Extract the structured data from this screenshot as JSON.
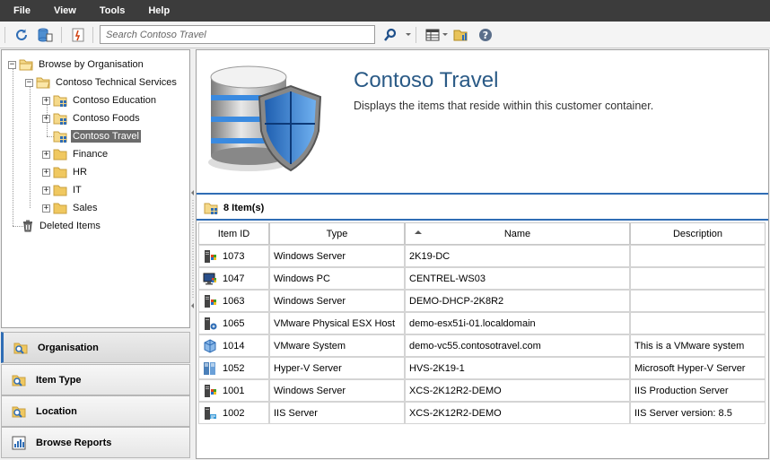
{
  "menu": [
    "File",
    "View",
    "Tools",
    "Help"
  ],
  "toolbar": {
    "search_placeholder": "Search Contoso Travel",
    "icons": [
      "refresh-icon",
      "database-icon",
      "report-icon",
      "search-icon",
      "columns-icon",
      "folder-chart-icon",
      "help-icon"
    ]
  },
  "tree": {
    "root": "Browse by Organisation",
    "customer": "Contoso Technical Services",
    "children": [
      "Contoso Education",
      "Contoso Foods",
      "Contoso Travel"
    ],
    "folders": [
      "Finance",
      "HR",
      "IT",
      "Sales"
    ],
    "deleted": "Deleted Items"
  },
  "nav": {
    "organisation": "Organisation",
    "item_type": "Item Type",
    "location": "Location",
    "browse_reports": "Browse Reports"
  },
  "banner": {
    "title": "Contoso Travel",
    "description": "Displays the items that reside within this customer container."
  },
  "items_count": "8 Item(s)",
  "grid": {
    "columns": [
      "Item ID",
      "Type",
      "Name",
      "Description"
    ],
    "rows": [
      {
        "id": "1073",
        "type": "Windows Server",
        "name": "2K19-DC",
        "description": "",
        "icon": "server"
      },
      {
        "id": "1047",
        "type": "Windows PC",
        "name": "CENTREL-WS03",
        "description": "",
        "icon": "pc"
      },
      {
        "id": "1063",
        "type": "Windows Server",
        "name": "DEMO-DHCP-2K8R2",
        "description": "",
        "icon": "server"
      },
      {
        "id": "1065",
        "type": "VMware Physical ESX Host",
        "name": "demo-esx51i-01.localdomain",
        "description": "",
        "icon": "esx"
      },
      {
        "id": "1014",
        "type": "VMware System",
        "name": "demo-vc55.contosotravel.com",
        "description": "This is a VMware system",
        "icon": "vmware"
      },
      {
        "id": "1052",
        "type": "Hyper-V Server",
        "name": "HVS-2K19-1",
        "description": "Microsoft Hyper-V Server",
        "icon": "hyperv"
      },
      {
        "id": "1001",
        "type": "Windows Server",
        "name": "XCS-2K12R2-DEMO",
        "description": "IIS Production Server",
        "icon": "server"
      },
      {
        "id": "1002",
        "type": "IIS Server",
        "name": "XCS-2K12R2-DEMO",
        "description": "IIS Server version: 8.5",
        "icon": "iis"
      }
    ]
  },
  "colors": {
    "accent": "#2f6db5",
    "title": "#2a5a86",
    "menubar": "#3c3c3c"
  }
}
